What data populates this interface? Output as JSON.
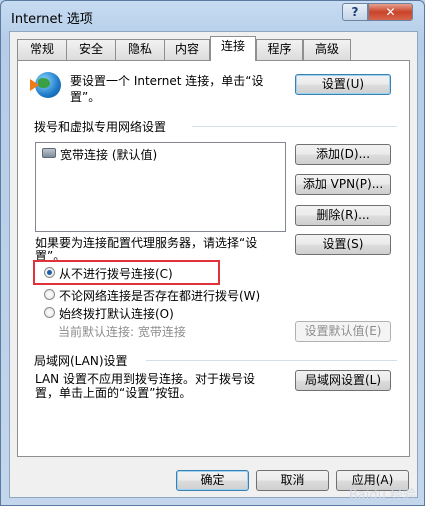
{
  "window": {
    "title": "Internet 选项",
    "help_label": "?",
    "close_label": "✕"
  },
  "tabs": [
    {
      "label": "常规",
      "active": false
    },
    {
      "label": "安全",
      "active": false
    },
    {
      "label": "隐私",
      "active": false
    },
    {
      "label": "内容",
      "active": false
    },
    {
      "label": "连接",
      "active": true
    },
    {
      "label": "程序",
      "active": false
    },
    {
      "label": "高级",
      "active": false
    }
  ],
  "setup": {
    "text_line1": "要设置一个 Internet 连接，单击“设",
    "text_line2": "置”。",
    "button_label": "设置(U)"
  },
  "dialup": {
    "title": "拨号和虚拟专用网络设置",
    "items": [
      {
        "label": "宽带连接 (默认值)"
      }
    ],
    "add_label": "添加(D)...",
    "add_vpn_label": "添加 VPN(P)...",
    "remove_label": "删除(R)...",
    "proxy_text_line1": "如果要为连接配置代理服务器，请选择“设",
    "proxy_text_line2": "置”。",
    "settings_label": "设置(S)"
  },
  "radios": [
    {
      "label": "从不进行拨号连接(C)",
      "checked": true
    },
    {
      "label": "不论网络连接是否存在都进行拨号(W)",
      "checked": false
    },
    {
      "label": "始终拨打默认连接(O)",
      "checked": false
    }
  ],
  "current_default": {
    "label": "当前默认连接:",
    "value": "宽带连接",
    "set_default_label": "设置默认值(E)"
  },
  "lan": {
    "title": "局域网(LAN)设置",
    "text_line1": "LAN 设置不应用到拨号连接。对于拨号设",
    "text_line2": "置，单击上面的“设置”按钮。",
    "button_label": "局域网设置(L)"
  },
  "footer": {
    "ok_label": "确定",
    "cancel_label": "取消",
    "apply_label": "应用(A)"
  },
  "watermark": "Baidu 经验"
}
